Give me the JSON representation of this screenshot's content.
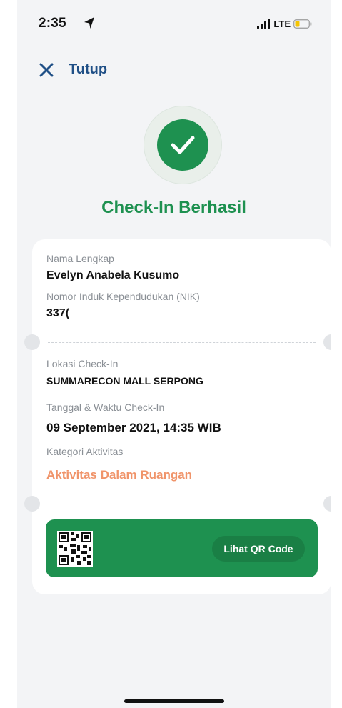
{
  "status_bar": {
    "time": "2:35",
    "network": "LTE",
    "battery_color": "#f5c400"
  },
  "header": {
    "close_label": "Tutup"
  },
  "result": {
    "title": "Check-In Berhasil",
    "accent_color": "#1e9150"
  },
  "card": {
    "name_label": "Nama Lengkap",
    "name_value": "Evelyn Anabela Kusumo",
    "nik_label": "Nomor Induk Kependudukan (NIK)",
    "nik_value": "337(",
    "location_label": "Lokasi Check-In",
    "location_value": "SUMMARECON MALL SERPONG",
    "datetime_label": "Tanggal & Waktu Check-In",
    "datetime_value": "09 September 2021, 14:35 WIB",
    "category_label": "Kategori Aktivitas",
    "category_value": "Aktivitas Dalam Ruangan",
    "category_color": "#f0946a"
  },
  "qr": {
    "icon": "qr-code-icon",
    "button_label": "Lihat QR Code"
  }
}
